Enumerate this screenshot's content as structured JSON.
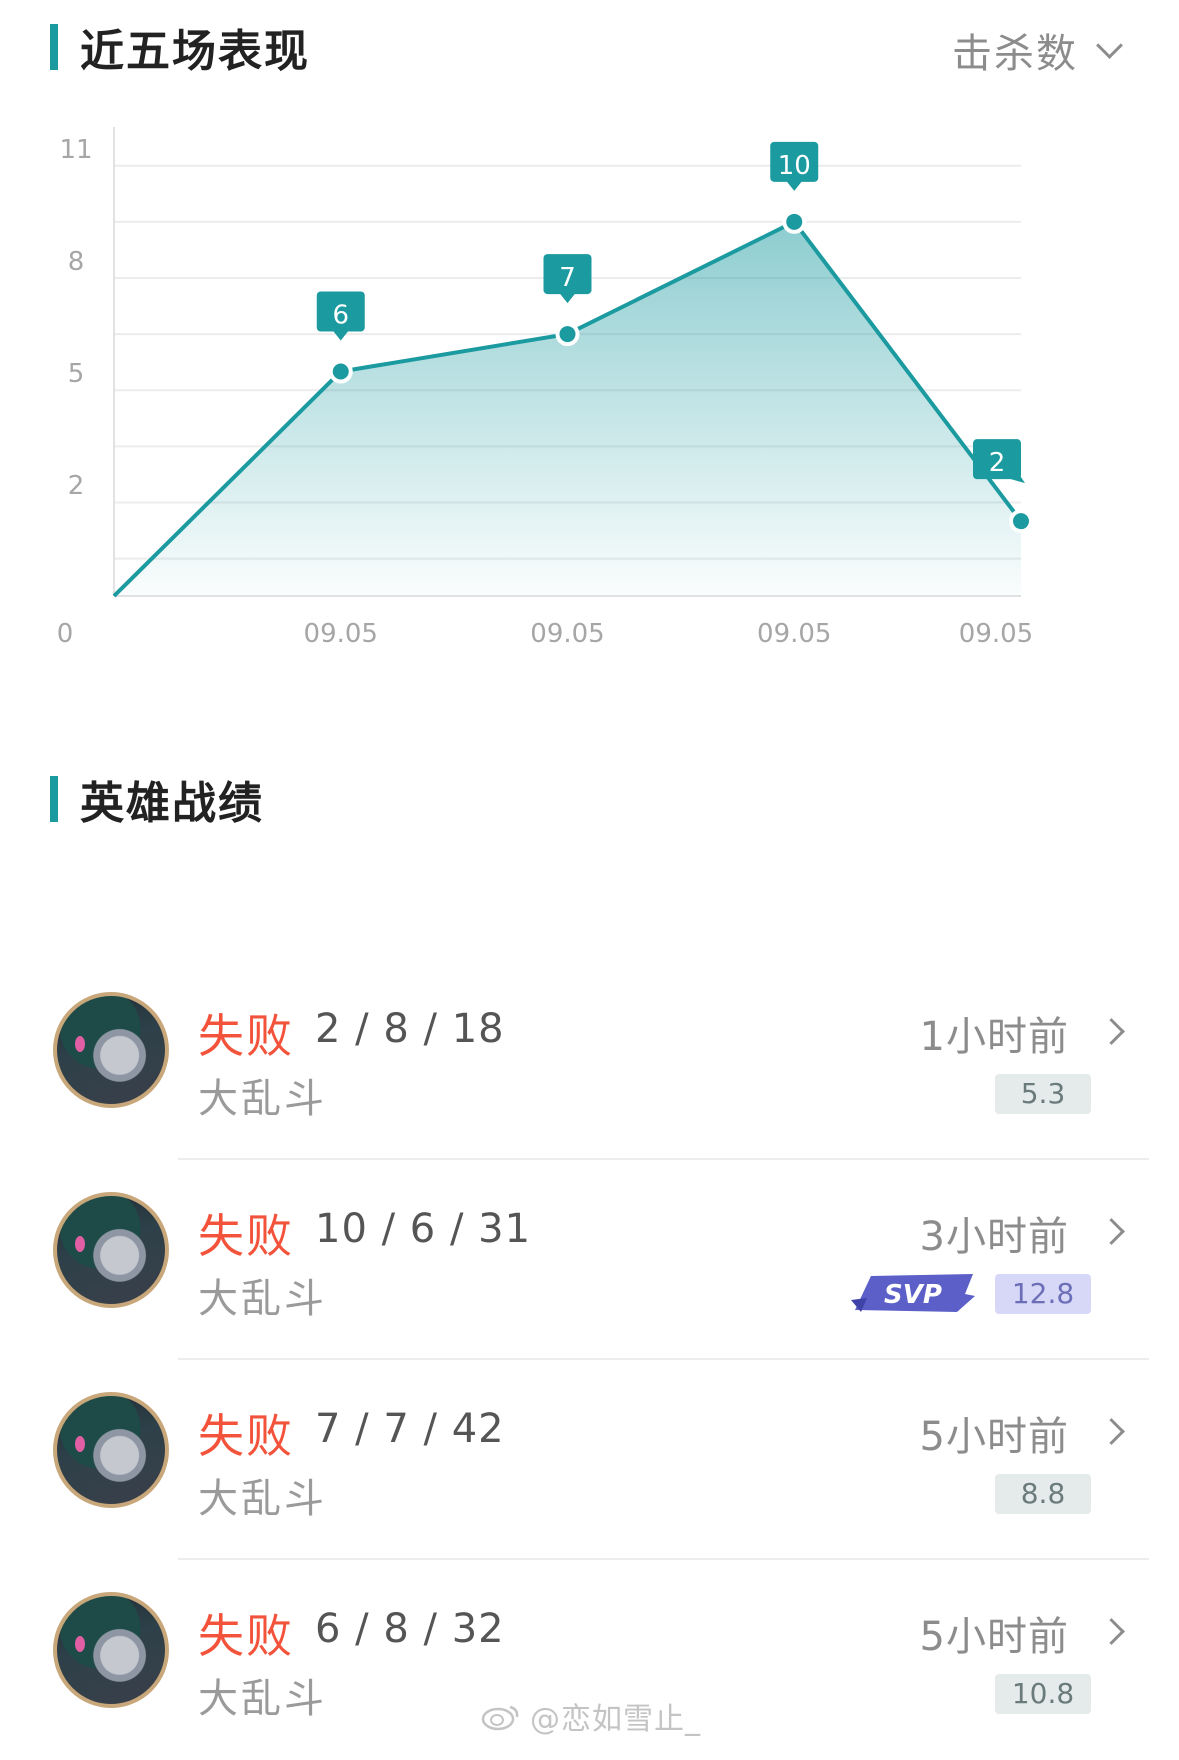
{
  "performance": {
    "title": "近五场表现",
    "metric_selected": "击杀数"
  },
  "chart_data": {
    "type": "area",
    "title": "近五场表现",
    "metric": "击杀数",
    "x": [
      "",
      "09.05",
      "09.05",
      "09.05",
      "09.05"
    ],
    "x_tick_labels": [
      "09.05",
      "09.05",
      "09.05",
      "09.05"
    ],
    "series": [
      {
        "values": [
          0,
          6,
          7,
          10,
          2
        ],
        "data_labels": [
          "6",
          "7",
          "10",
          "2"
        ]
      }
    ],
    "y_tick_labels": [
      "0",
      "2",
      "5",
      "8",
      "11"
    ],
    "ylim": [
      0,
      12
    ],
    "grid": true,
    "color": "#1b9aa0"
  },
  "heroes": {
    "title": "英雄战绩",
    "matches": [
      {
        "result": "失败",
        "kda": "2 / 8 / 18",
        "mode": "大乱斗",
        "time": "1小时前",
        "score": "5.3",
        "svp": false
      },
      {
        "result": "失败",
        "kda": "10 / 6 / 31",
        "mode": "大乱斗",
        "time": "3小时前",
        "score": "12.8",
        "svp": true,
        "svp_label": "SVP"
      },
      {
        "result": "失败",
        "kda": "7 / 7 / 42",
        "mode": "大乱斗",
        "time": "5小时前",
        "score": "8.8",
        "svp": false
      },
      {
        "result": "失败",
        "kda": "6 / 8 / 32",
        "mode": "大乱斗",
        "time": "5小时前",
        "score": "10.8",
        "svp": false
      }
    ]
  },
  "watermark": "@恋如雪止_",
  "colors": {
    "accent": "#1b9aa0",
    "loss": "#f3533b",
    "svp": "#5b5fc7"
  }
}
